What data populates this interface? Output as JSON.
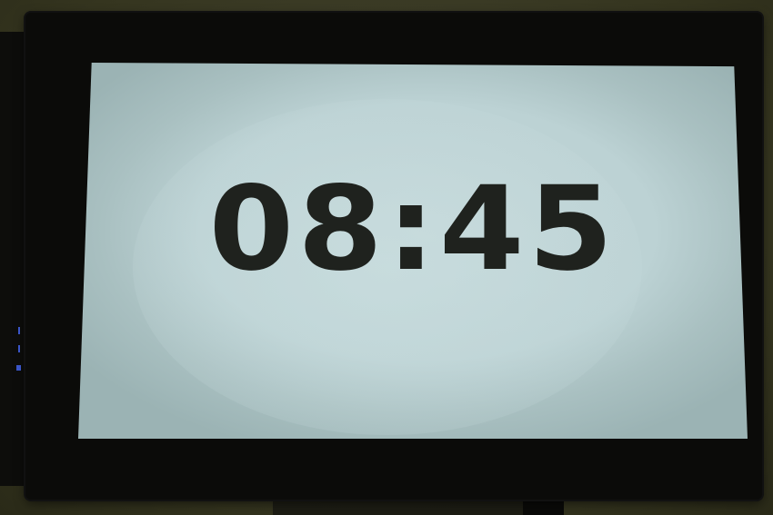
{
  "display": {
    "time": "08:45"
  },
  "colors": {
    "bezel": "#0b0b09",
    "screen": "#bcd2d4",
    "digits": "#1f221e",
    "background": "#3a3a26",
    "led": "#3a55c8"
  }
}
